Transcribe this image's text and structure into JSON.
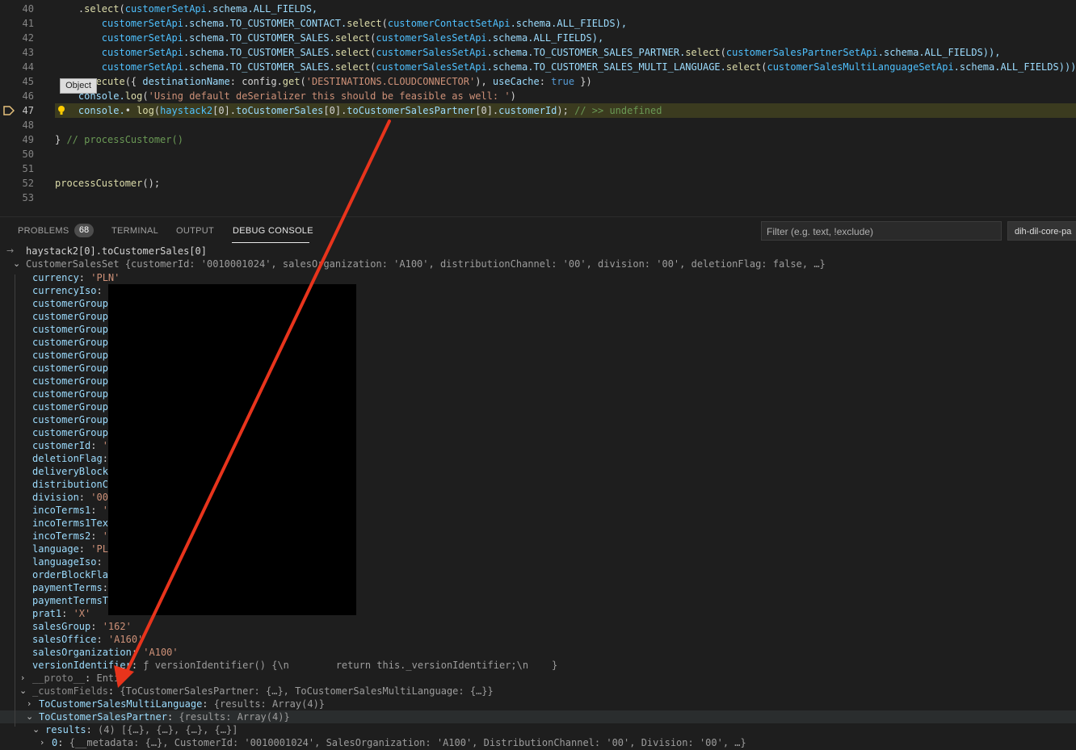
{
  "editor": {
    "lines": [
      {
        "num": "40",
        "segments": [
          {
            "t": "    .",
            "c": "k-plain"
          },
          {
            "t": "select",
            "c": "k-fn"
          },
          {
            "t": "(",
            "c": "k-plain"
          },
          {
            "t": "customerSetApi",
            "c": "k-var"
          },
          {
            "t": ".schema.ALL_FIELDS,",
            "c": "k-prop"
          }
        ]
      },
      {
        "num": "41",
        "segments": [
          {
            "t": "        customerSetApi",
            "c": "k-var"
          },
          {
            "t": ".schema.TO_CUSTOMER_CONTACT.",
            "c": "k-prop"
          },
          {
            "t": "select",
            "c": "k-fn"
          },
          {
            "t": "(",
            "c": "k-plain"
          },
          {
            "t": "customerContactSetApi",
            "c": "k-var"
          },
          {
            "t": ".schema.ALL_FIELDS),",
            "c": "k-prop"
          }
        ]
      },
      {
        "num": "42",
        "segments": [
          {
            "t": "        customerSetApi",
            "c": "k-var"
          },
          {
            "t": ".schema.TO_CUSTOMER_SALES.",
            "c": "k-prop"
          },
          {
            "t": "select",
            "c": "k-fn"
          },
          {
            "t": "(",
            "c": "k-plain"
          },
          {
            "t": "customerSalesSetApi",
            "c": "k-var"
          },
          {
            "t": ".schema.ALL_FIELDS),",
            "c": "k-prop"
          }
        ]
      },
      {
        "num": "43",
        "segments": [
          {
            "t": "        customerSetApi",
            "c": "k-var"
          },
          {
            "t": ".schema.TO_CUSTOMER_SALES.",
            "c": "k-prop"
          },
          {
            "t": "select",
            "c": "k-fn"
          },
          {
            "t": "(",
            "c": "k-plain"
          },
          {
            "t": "customerSalesSetApi",
            "c": "k-var"
          },
          {
            "t": ".schema.TO_CUSTOMER_SALES_PARTNER.",
            "c": "k-prop"
          },
          {
            "t": "select",
            "c": "k-fn"
          },
          {
            "t": "(",
            "c": "k-plain"
          },
          {
            "t": "customerSalesPartnerSetApi",
            "c": "k-var"
          },
          {
            "t": ".schema.ALL_FIELDS)),",
            "c": "k-prop"
          }
        ]
      },
      {
        "num": "44",
        "segments": [
          {
            "t": "        customerSetApi",
            "c": "k-var"
          },
          {
            "t": ".schema.TO_CUSTOMER_SALES.",
            "c": "k-prop"
          },
          {
            "t": "select",
            "c": "k-fn"
          },
          {
            "t": "(",
            "c": "k-plain"
          },
          {
            "t": "customerSalesSetApi",
            "c": "k-var"
          },
          {
            "t": ".schema.TO_CUSTOMER_SALES_MULTI_LANGUAGE.",
            "c": "k-prop"
          },
          {
            "t": "select",
            "c": "k-fn"
          },
          {
            "t": "(",
            "c": "k-plain"
          },
          {
            "t": "customerSalesMultiLanguageSetApi",
            "c": "k-var"
          },
          {
            "t": ".schema.ALL_FIELDS)))",
            "c": "k-prop"
          }
        ]
      },
      {
        "num": "45",
        "segments": [
          {
            "t": "       ecute",
            "c": "k-fn"
          },
          {
            "t": "({ ",
            "c": "k-plain"
          },
          {
            "t": "destinationName",
            "c": "k-prop"
          },
          {
            "t": ": config.",
            "c": "k-plain"
          },
          {
            "t": "get",
            "c": "k-fn"
          },
          {
            "t": "(",
            "c": "k-plain"
          },
          {
            "t": "'DESTINATIONS.CLOUDCONNECTOR'",
            "c": "k-str"
          },
          {
            "t": "), ",
            "c": "k-plain"
          },
          {
            "t": "useCache",
            "c": "k-prop"
          },
          {
            "t": ": ",
            "c": "k-plain"
          },
          {
            "t": "true",
            "c": "k-bool"
          },
          {
            "t": " })",
            "c": "k-plain"
          }
        ]
      },
      {
        "num": "46",
        "segments": [
          {
            "t": "    console.",
            "c": "k-prop"
          },
          {
            "t": "log",
            "c": "k-fn"
          },
          {
            "t": "(",
            "c": "k-plain"
          },
          {
            "t": "'Using default deSerializer this should be feasible as well: '",
            "c": "k-str"
          },
          {
            "t": ")",
            "c": "k-plain"
          }
        ]
      },
      {
        "num": "47",
        "active": true,
        "segments": [
          {
            "t": "    console.",
            "c": "k-prop"
          },
          {
            "t": "• ",
            "c": "k-plain"
          },
          {
            "t": "log",
            "c": "k-fn"
          },
          {
            "t": "(",
            "c": "k-plain"
          },
          {
            "t": "haystack2",
            "c": "k-cyan"
          },
          {
            "t": "[0].",
            "c": "k-plain"
          },
          {
            "t": "toCustomerSales",
            "c": "k-prop"
          },
          {
            "t": "[0].",
            "c": "k-plain"
          },
          {
            "t": "toCustomerSalesPartner",
            "c": "k-prop"
          },
          {
            "t": "[0].",
            "c": "k-plain"
          },
          {
            "t": "customerId",
            "c": "k-prop"
          },
          {
            "t": "); ",
            "c": "k-plain"
          },
          {
            "t": "// >> undefined",
            "c": "k-com"
          }
        ]
      },
      {
        "num": "48",
        "segments": []
      },
      {
        "num": "49",
        "segments": [
          {
            "t": "} ",
            "c": "k-plain"
          },
          {
            "t": "// processCustomer()",
            "c": "k-com"
          }
        ]
      },
      {
        "num": "50",
        "segments": []
      },
      {
        "num": "51",
        "segments": []
      },
      {
        "num": "52",
        "segments": [
          {
            "t": "processCustomer",
            "c": "k-fn"
          },
          {
            "t": "();",
            "c": "k-plain"
          }
        ]
      },
      {
        "num": "53",
        "segments": []
      }
    ],
    "tooltip": "Object"
  },
  "panel": {
    "tabs": [
      "PROBLEMS",
      "TERMINAL",
      "OUTPUT",
      "DEBUG CONSOLE"
    ],
    "problems_count": "68",
    "filter_placeholder": "Filter (e.g. text, !exclude)",
    "session_select": "dih-dil-core-pa"
  },
  "console": {
    "input_expr": "haystack2[0].toCustomerSales[0]",
    "root_summary": "CustomerSalesSet {customerId: '0010001024', salesOrganization: 'A100', distributionChannel: '00', division: '00', deletionFlag: false, …}",
    "props": [
      {
        "k": "currency",
        "v": "'PLN'"
      },
      {
        "k": "currencyIso",
        "v": ""
      },
      {
        "k": "customerGroup",
        "v": ""
      },
      {
        "k": "customerGroup",
        "v": ""
      },
      {
        "k": "customerGroup",
        "v": ""
      },
      {
        "k": "customerGroup",
        "v": ""
      },
      {
        "k": "customerGroup",
        "v": ""
      },
      {
        "k": "customerGroup",
        "v": ""
      },
      {
        "k": "customerGroup",
        "v": ""
      },
      {
        "k": "customerGroup",
        "v": ""
      },
      {
        "k": "customerGroup",
        "v": ""
      },
      {
        "k": "customerGroup",
        "v": ""
      },
      {
        "k": "customerGroup",
        "v": ""
      },
      {
        "k": "customerId",
        "v": "'("
      },
      {
        "k": "deletionFlag",
        "v": ""
      },
      {
        "k": "deliveryBlock",
        "v": ""
      },
      {
        "k": "distributionC",
        "v": ""
      },
      {
        "k": "division",
        "v": "'00"
      },
      {
        "k": "incoTerms1",
        "v": "'"
      },
      {
        "k": "incoTerms1Tex",
        "v": ""
      },
      {
        "k": "incoTerms2",
        "v": "'"
      },
      {
        "k": "language",
        "v": "'PL"
      },
      {
        "k": "languageIso",
        "v": ""
      },
      {
        "k": "orderBlockFla",
        "v": ""
      },
      {
        "k": "paymentTerms",
        "v": ""
      },
      {
        "k": "paymentTermsT",
        "v": ""
      },
      {
        "k": "prat1",
        "v": "'X'"
      },
      {
        "k": "salesGroup",
        "v": "'162'"
      },
      {
        "k": "salesOffice",
        "v": "'A160'"
      },
      {
        "k": "salesOrganization",
        "v": "'A100'"
      }
    ],
    "version_key": "versionIdentifier",
    "version_val": "ƒ versionIdentifier() {\\n        return this._versionIdentifier;\\n    }",
    "proto_key": "__proto__",
    "proto_val": "Enti",
    "custom_key": "_customFields",
    "custom_val": "{ToCustomerSalesPartner: {…}, ToCustomerSalesMultiLanguage: {…}}",
    "multi_key": "ToCustomerSalesMultiLanguage",
    "multi_val": "{results: Array(4)}",
    "partner_key": "ToCustomerSalesPartner",
    "partner_val": "{results: Array(4)}",
    "results_key": "results",
    "results_val": "(4) [{…}, {…}, {…}, {…}]",
    "item0_key": "0",
    "item0_val": "{__metadata: {…}, CustomerId: '0010001024', SalesOrganization: 'A100', DistributionChannel: '00', Division: '00', …}"
  },
  "colors": {
    "background": "#1e1e1e",
    "arrow": "#e8341c",
    "active_line": "#3b3b1f"
  }
}
